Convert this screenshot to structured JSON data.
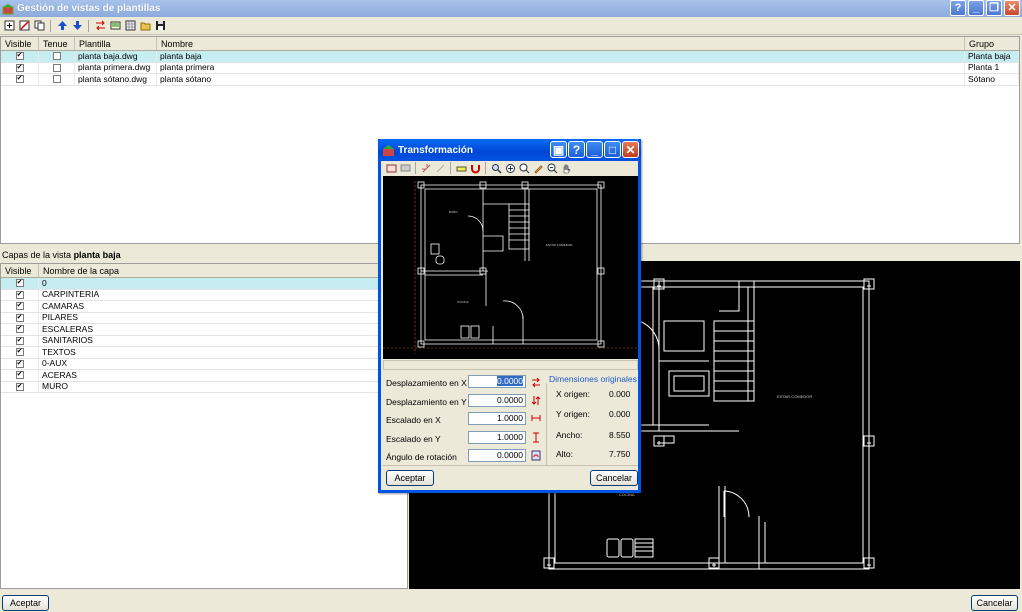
{
  "window": {
    "title": "Gestión de vistas de plantillas"
  },
  "top_table": {
    "headers": {
      "visible": "Visible",
      "tenue": "Tenue",
      "plantilla": "Plantilla",
      "nombre": "Nombre",
      "grupo": "Grupo"
    },
    "rows": [
      {
        "visible": true,
        "tenue": false,
        "plantilla": "planta baja.dwg",
        "nombre": "planta baja",
        "grupo": "Planta baja"
      },
      {
        "visible": true,
        "tenue": false,
        "plantilla": "planta primera.dwg",
        "nombre": "planta primera",
        "grupo": "Planta 1"
      },
      {
        "visible": true,
        "tenue": false,
        "plantilla": "planta sótano.dwg",
        "nombre": "planta sótano",
        "grupo": "Sótano"
      }
    ]
  },
  "layers": {
    "label": "Capas de la vista",
    "view_name": "planta baja",
    "headers": {
      "visible": "Visible",
      "name": "Nombre de la capa"
    },
    "rows": [
      {
        "visible": true,
        "name": "0"
      },
      {
        "visible": true,
        "name": "CARPINTERIA"
      },
      {
        "visible": true,
        "name": "CAMARAS"
      },
      {
        "visible": true,
        "name": "PILARES"
      },
      {
        "visible": true,
        "name": "ESCALERAS"
      },
      {
        "visible": true,
        "name": "SANITARIOS"
      },
      {
        "visible": true,
        "name": "TEXTOS"
      },
      {
        "visible": true,
        "name": "0-AUX"
      },
      {
        "visible": true,
        "name": "ACERAS"
      },
      {
        "visible": true,
        "name": "MURO"
      }
    ]
  },
  "drawing_labels": {
    "estar": "ESTAR-COMEDOR",
    "cocina": "COCINA"
  },
  "preview_labels": {
    "bano": "BAÑO",
    "estar": "ESTAR-COMEDOR",
    "cocina": "COCINA"
  },
  "buttons": {
    "aceptar": "Aceptar",
    "cancelar": "Cancelar"
  },
  "dialog": {
    "title": "Transformación",
    "fields": {
      "desp_x": {
        "label": "Desplazamiento en X",
        "value": "0.0000"
      },
      "desp_y": {
        "label": "Desplazamiento en Y",
        "value": "0.0000"
      },
      "esc_x": {
        "label": "Escalado en X",
        "value": "1.0000"
      },
      "esc_y": {
        "label": "Escalado en Y",
        "value": "1.0000"
      },
      "angulo": {
        "label": "Ángulo de rotación",
        "value": "0.0000"
      }
    },
    "dims": {
      "title": "Dimensiones originales",
      "x_origen": {
        "label": "X origen:",
        "value": "0.000"
      },
      "y_origen": {
        "label": "Y origen:",
        "value": "0.000"
      },
      "ancho": {
        "label": "Ancho:",
        "value": "8.550"
      },
      "alto": {
        "label": "Alto:",
        "value": "7.750"
      }
    },
    "buttons": {
      "aceptar": "Aceptar",
      "cancelar": "Cancelar"
    }
  },
  "colors": {
    "titlebar": "#8caadd",
    "selected_row": "#c6eef2",
    "dialog_border": "#0054e3",
    "dims_title": "#1c5bc2"
  }
}
